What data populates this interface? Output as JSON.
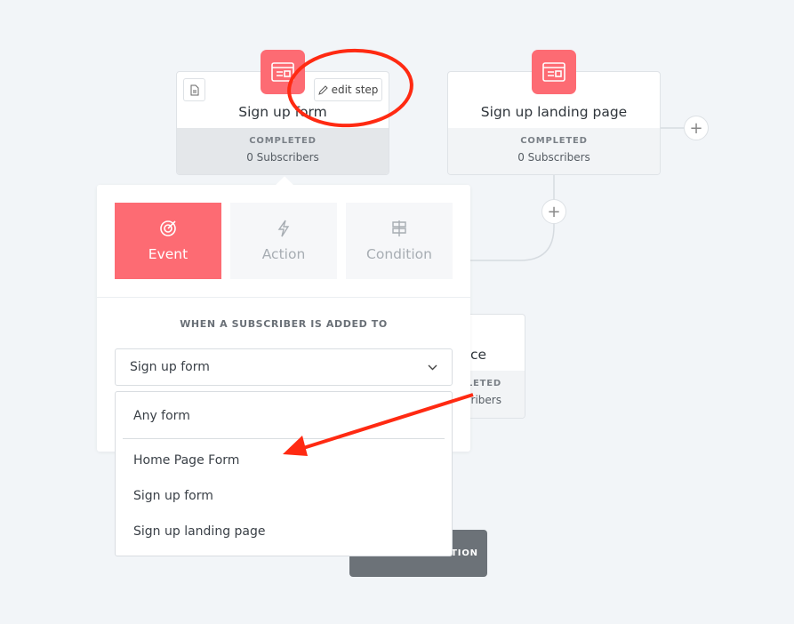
{
  "steps": [
    {
      "title": "Sign up form",
      "status": "COMPLETED",
      "subscribers": "0 Subscribers",
      "edit_label": "edit step"
    },
    {
      "title": "Sign up landing page",
      "status": "COMPLETED",
      "subscribers": "0 Subscribers"
    },
    {
      "title": "ce",
      "status": "LETED",
      "subscribers": "cribers"
    }
  ],
  "end_button": "END OF AUTOMATION",
  "panel": {
    "tabs": [
      {
        "label": "Event",
        "icon": "target-icon"
      },
      {
        "label": "Action",
        "icon": "lightning-icon"
      },
      {
        "label": "Condition",
        "icon": "signpost-icon"
      }
    ],
    "heading": "WHEN A SUBSCRIBER IS ADDED TO",
    "select_value": "Sign up form",
    "options": [
      "Any form",
      "Home Page Form",
      "Sign up form",
      "Sign up landing page"
    ]
  },
  "colors": {
    "accent": "#fd6b73",
    "annotation": "#ff2a12"
  }
}
